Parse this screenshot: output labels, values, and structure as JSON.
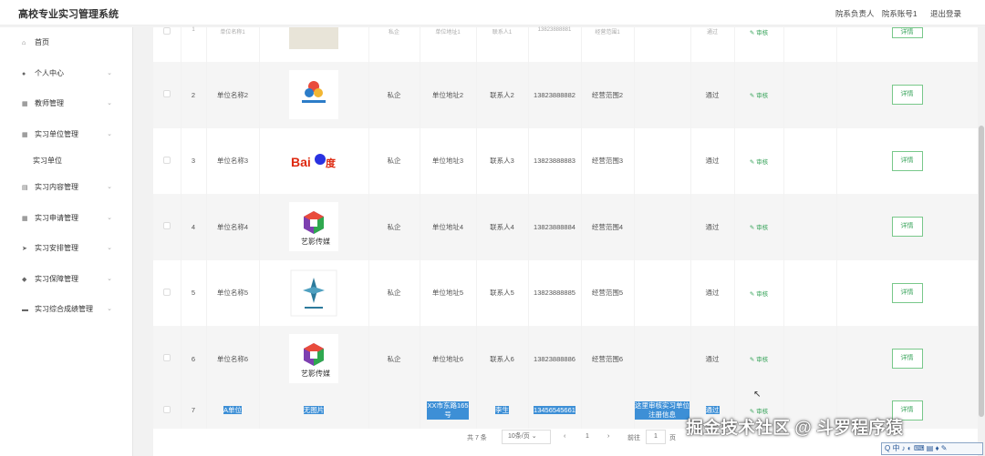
{
  "app_title": "高校专业实习管理系统",
  "header": {
    "role": "院系负责人",
    "account": "院系账号1",
    "logout": "退出登录"
  },
  "sidebar": {
    "items": [
      {
        "label": "首页",
        "icon": "home-icon",
        "glyph": "⌂",
        "chevron": false
      },
      {
        "label": "个人中心",
        "icon": "user-icon",
        "glyph": "●",
        "chevron": true
      },
      {
        "label": "教师管理",
        "icon": "grid-icon",
        "glyph": "▦",
        "chevron": true
      },
      {
        "label": "实习单位管理",
        "icon": "grid-icon",
        "glyph": "▦",
        "chevron": true
      }
    ],
    "sub_item": "实习单位",
    "items2": [
      {
        "label": "实习内容管理",
        "icon": "briefcase-icon",
        "glyph": "▤",
        "chevron": true
      },
      {
        "label": "实习申请管理",
        "icon": "grid-icon",
        "glyph": "▦",
        "chevron": true
      },
      {
        "label": "实习安排管理",
        "icon": "send-icon",
        "glyph": "➤",
        "chevron": true
      },
      {
        "label": "实习保障管理",
        "icon": "shield-icon",
        "glyph": "◆",
        "chevron": true
      },
      {
        "label": "实习综合成绩管理",
        "icon": "chart-icon",
        "glyph": "▬",
        "chevron": true
      }
    ]
  },
  "table": {
    "audit_label": "✎ 审核",
    "detail_label": "详情",
    "top_row": {
      "index": "1",
      "name": "单位名称1",
      "type": "私企",
      "address": "单位地址1",
      "contact": "联系人1",
      "phone": "13823888881",
      "scope": "经营范围1",
      "status": "通过"
    },
    "rows": [
      {
        "index": "2",
        "name": "单位名称2",
        "logo": "BRAVOSS",
        "type": "私企",
        "address": "单位地址2",
        "contact": "联系人2",
        "phone": "13823888882",
        "scope": "经营范围2",
        "note": "",
        "status": "通过"
      },
      {
        "index": "3",
        "name": "单位名称3",
        "logo": "Bai百度",
        "type": "私企",
        "address": "单位地址3",
        "contact": "联系人3",
        "phone": "13823888883",
        "scope": "经营范围3",
        "note": "",
        "status": "通过"
      },
      {
        "index": "4",
        "name": "单位名称4",
        "logo": "艺影传媒",
        "type": "私企",
        "address": "单位地址4",
        "contact": "联系人4",
        "phone": "13823888884",
        "scope": "经营范围4",
        "note": "",
        "status": "通过"
      },
      {
        "index": "5",
        "name": "单位名称5",
        "logo": "",
        "type": "私企",
        "address": "单位地址5",
        "contact": "联系人5",
        "phone": "13823888885",
        "scope": "经营范围5",
        "note": "",
        "status": "通过"
      },
      {
        "index": "6",
        "name": "单位名称6",
        "logo": "艺影传媒",
        "type": "私企",
        "address": "单位地址6",
        "contact": "联系人6",
        "phone": "13823888886",
        "scope": "经营范围6",
        "note": "",
        "status": "通过"
      }
    ],
    "selected_row": {
      "index": "7",
      "name": "A单位",
      "logo_text": "无图片",
      "address": "XX市东路165号",
      "contact": "李生",
      "phone": "13456545661",
      "note": "这里审核实习单位注册信息",
      "status": "通过"
    }
  },
  "pagination": {
    "total": "共 7 条",
    "page_size": "10条/页",
    "prev": "‹",
    "current": "1",
    "next": "›",
    "goto_label": "前往",
    "goto_value": "1",
    "page_unit": "页"
  },
  "watermark": "掘金技术社区 @ 斗罗程序猿",
  "ime_bar": "Q 中 ♪ ◐ ⌨ ▤ ♦ ✎"
}
